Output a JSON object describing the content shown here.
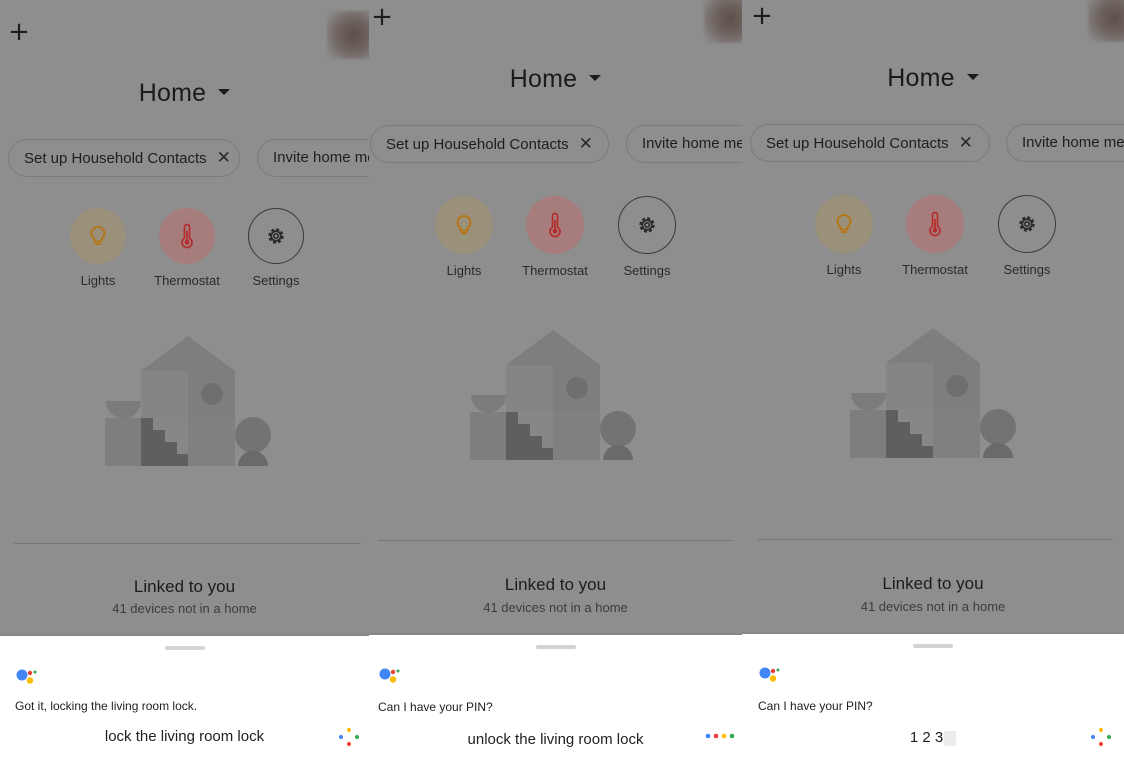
{
  "home_header": {
    "add_label": "+",
    "title": "Home"
  },
  "chips": {
    "household": "Set up Household Contacts",
    "invite": "Invite home me",
    "close_glyph": "✕"
  },
  "devices": [
    {
      "label": "Lights",
      "icon": "lightbulb-icon"
    },
    {
      "label": "Thermostat",
      "icon": "thermometer-icon"
    },
    {
      "label": "Settings",
      "icon": "gear-icon"
    }
  ],
  "linked": {
    "title": "Linked to you",
    "subtitle": "41 devices not in a home"
  },
  "panels": [
    {
      "assistant_reply": "Got it, locking the living room lock.",
      "user_query": "lock the living room lock"
    },
    {
      "assistant_reply": "Can I have your PIN?",
      "user_query": "unlock the living room lock"
    },
    {
      "assistant_reply": "Can I have your PIN?",
      "user_query": "1 2 3"
    }
  ],
  "colors": {
    "dim_background": "#8e8e8e",
    "assistant_blue": "#4285f4",
    "assistant_red": "#ea4335",
    "assistant_yellow": "#fbbc05",
    "assistant_green": "#34a853",
    "lights_accent": "#b6730e",
    "thermostat_accent": "#b42c2c"
  }
}
